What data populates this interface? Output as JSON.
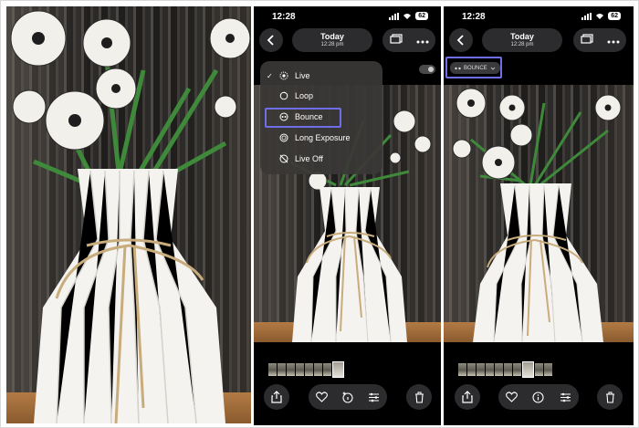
{
  "status": {
    "time": "12:28",
    "battery": "62"
  },
  "header": {
    "title": "Today",
    "subtitle": "12:28 pm"
  },
  "live_menu": {
    "items": [
      {
        "label": "Live",
        "icon": "live-icon",
        "checked": true
      },
      {
        "label": "Loop",
        "icon": "loop-icon",
        "checked": false
      },
      {
        "label": "Bounce",
        "icon": "bounce-icon",
        "checked": false
      },
      {
        "label": "Long Exposure",
        "icon": "long-exposure-icon",
        "checked": false
      },
      {
        "label": "Live Off",
        "icon": "live-off-icon",
        "checked": false
      }
    ],
    "check_glyph": "✓",
    "highlighted": "Bounce"
  },
  "effect_badge": {
    "label": "BOUNCE"
  },
  "colors": {
    "highlight": "#6f6ee8",
    "panel": "#2c2c2e",
    "background": "#000000"
  },
  "icons": {
    "back": "chevron-left-icon",
    "gallery": "photo-stack-icon",
    "more": "ellipsis-icon",
    "share": "share-icon",
    "favorite": "heart-icon",
    "info_edit": "sparkle-info-icon",
    "info": "info-icon",
    "adjust": "sliders-icon",
    "delete": "trash-icon"
  }
}
